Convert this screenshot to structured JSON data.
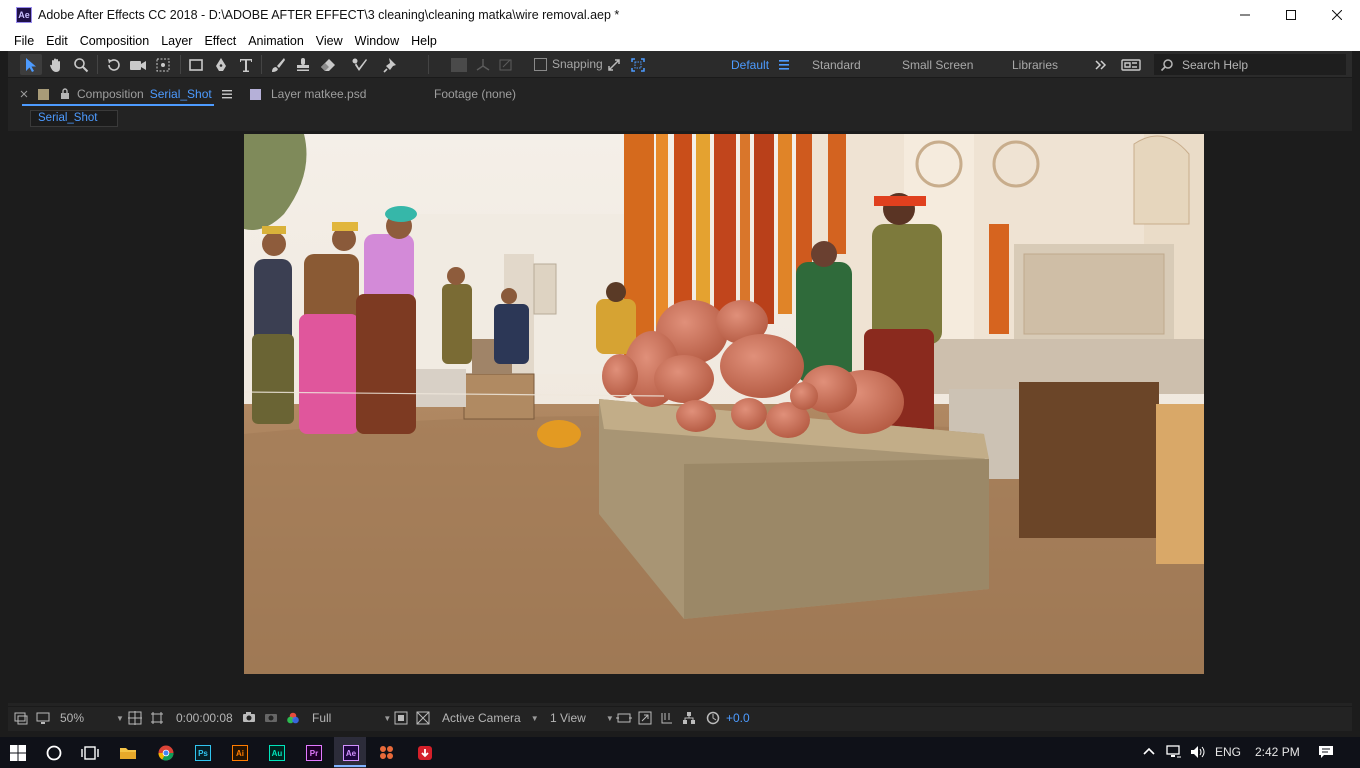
{
  "window": {
    "app_badge": "Ae",
    "title": "Adobe After Effects CC 2018 - D:\\ADOBE AFTER EFFECT\\3 cleaning\\cleaning matka\\wire removal.aep *"
  },
  "menu": [
    "File",
    "Edit",
    "Composition",
    "Layer",
    "Effect",
    "Animation",
    "View",
    "Window",
    "Help"
  ],
  "toolbar": {
    "snapping_label": "Snapping",
    "workspaces": [
      "Default",
      "Standard",
      "Small Screen",
      "Libraries"
    ],
    "active_workspace": "Default",
    "search_placeholder": "Search Help"
  },
  "panels": {
    "composition_tab": {
      "prefix": "Composition",
      "name": "Serial_Shot"
    },
    "layer_tab": "Layer  matkee.psd",
    "footage_tab": "Footage  (none)",
    "sub_tab": "Serial_Shot"
  },
  "viewer_bar": {
    "zoom": "50%",
    "timecode": "0:00:00:08",
    "resolution": "Full",
    "camera": "Active Camera",
    "views": "1 View",
    "exposure": "+0.0"
  },
  "taskbar": {
    "apps": [
      "start-button",
      "cortana",
      "task-view",
      "file-explorer",
      "chrome",
      "photoshop",
      "illustrator",
      "audition",
      "premiere",
      "after-effects",
      "app-8",
      "app-9"
    ],
    "language": "ENG",
    "time": "2:42 PM"
  },
  "colors": {
    "accent": "#4d9bff",
    "panel_bg": "#232323",
    "viewer_bg": "#1c1c1c"
  }
}
